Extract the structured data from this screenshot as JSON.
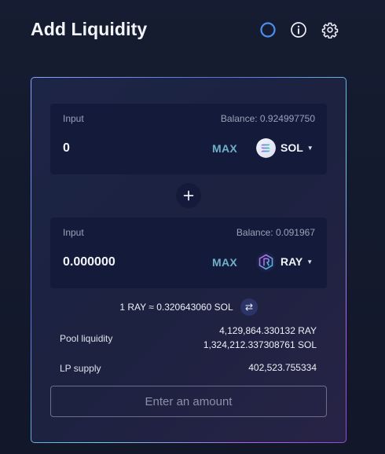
{
  "header": {
    "title": "Add Liquidity"
  },
  "input_a": {
    "label": "Input",
    "balance": "Balance: 0.924997750",
    "value": "0",
    "max_label": "MAX",
    "token": "SOL"
  },
  "input_b": {
    "label": "Input",
    "balance": "Balance: 0.091967",
    "value": "0.000000",
    "max_label": "MAX",
    "token": "RAY"
  },
  "rate": {
    "text": "1 RAY ≈ 0.320643060 SOL"
  },
  "pool": {
    "liquidity_label": "Pool liquidity",
    "liquidity_ray": "4,129,864.330132 RAY",
    "liquidity_sol": "1,324,212.337308761 SOL",
    "supply_label": "LP supply",
    "supply_value": "402,523.755334"
  },
  "submit": {
    "label": "Enter an amount"
  },
  "icons": {
    "refresh": "refresh-icon",
    "info": "info-icon",
    "settings": "gear-icon",
    "plus": "plus-icon",
    "swap": "swap-arrows-icon",
    "sol_logo": "solana-logo",
    "ray_logo": "raydium-logo",
    "caret": "caret-down-icon"
  },
  "colors": {
    "background": "#141a2e",
    "panel": "#141b3a",
    "max_accent": "#6fb0c9",
    "refresh_accent": "#4d8ef0",
    "border_gradient": [
      "#8aa6ff",
      "#6cd3e6",
      "#b25cf0"
    ]
  }
}
